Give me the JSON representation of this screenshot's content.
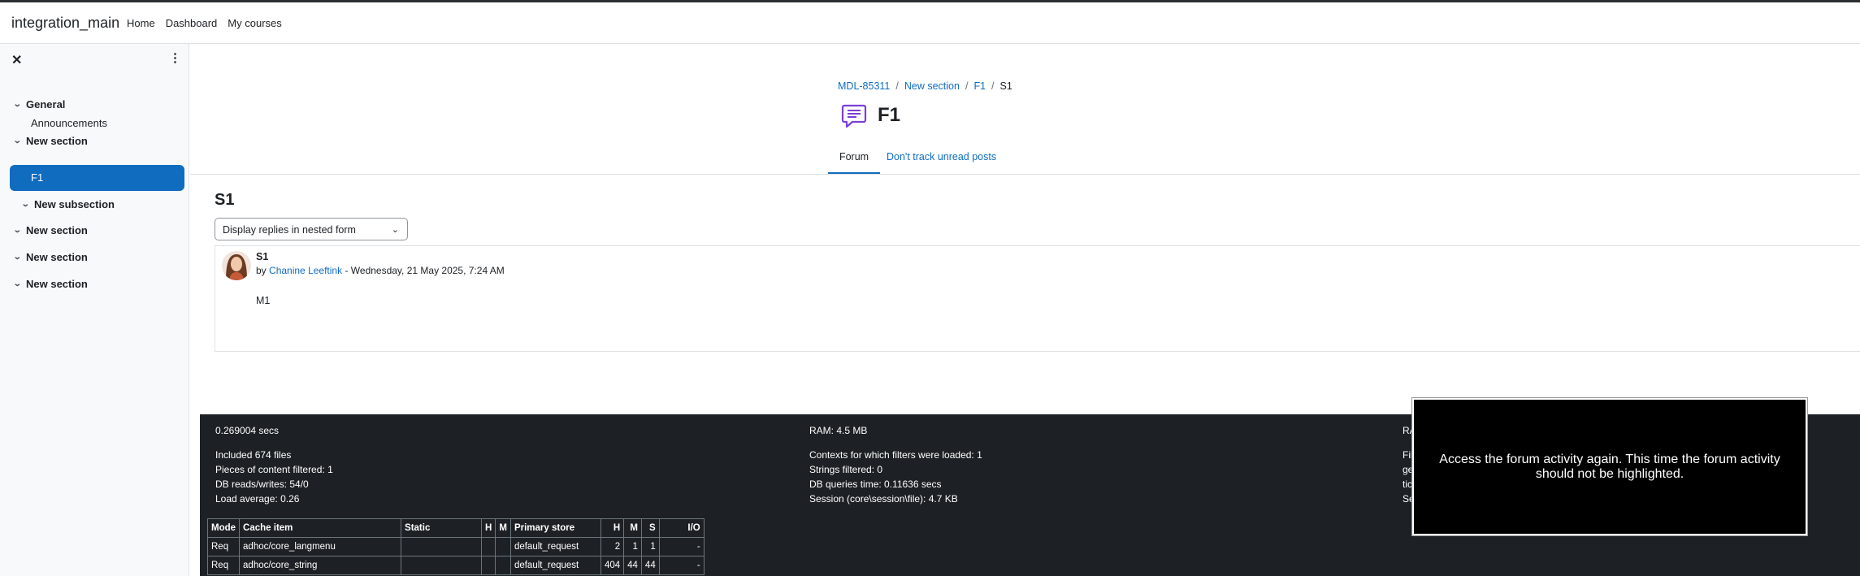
{
  "navbar": {
    "brand": "integration_main",
    "links": [
      "Home",
      "Dashboard",
      "My courses"
    ]
  },
  "course_index": {
    "close_icon": "close-icon",
    "menu_icon": "kebab-menu-icon",
    "items": [
      {
        "label": "General",
        "type": "section"
      },
      {
        "label": "Announcements",
        "type": "activity"
      },
      {
        "label": "New section",
        "type": "section"
      },
      {
        "label": "F1",
        "type": "activity",
        "active": true
      },
      {
        "label": "New subsection",
        "type": "subsection"
      },
      {
        "label": "New section",
        "type": "section"
      },
      {
        "label": "New section",
        "type": "section"
      },
      {
        "label": "New section",
        "type": "section"
      }
    ]
  },
  "breadcrumb": [
    "MDL-85311",
    "New section",
    "F1",
    "S1"
  ],
  "page": {
    "title": "F1",
    "icon": "forum-icon",
    "tabs": [
      {
        "label": "Forum",
        "active": true
      },
      {
        "label": "Don't track unread posts",
        "active": false
      }
    ]
  },
  "discussion": {
    "title": "S1",
    "display_mode": "Display replies in nested form",
    "post": {
      "subject": "S1",
      "by": "by",
      "author": "Chanine Leeftink",
      "date": "- Wednesday, 21 May 2025, 7:24 AM",
      "message": "M1"
    }
  },
  "footer": {
    "col1": {
      "time": "0.269004 secs",
      "lines": [
        "Included 674 files",
        "Pieces of content filtered: 1",
        "DB reads/writes: 54/0",
        "Load average: 0.26"
      ]
    },
    "col2": {
      "ram": "RAM: 4.5 MB",
      "lines": [
        "Contexts for which filters were loaded: 1",
        "Strings filtered: 0",
        "DB queries time: 0.11636 secs",
        "Session (core\\session\\file): 4.7 KB"
      ]
    },
    "col3": {
      "head": "RA",
      "lines": [
        "Fil",
        "ge",
        "tic",
        "Se"
      ]
    },
    "table": {
      "headers": [
        "Mode",
        "Cache item",
        "Static",
        "H",
        "M",
        "Primary store",
        "H",
        "M",
        "S",
        "I/O"
      ],
      "rows": [
        [
          "Req",
          "adhoc/core_langmenu",
          "",
          "",
          "",
          "default_request",
          "2",
          "1",
          "1",
          "-"
        ],
        [
          "Req",
          "adhoc/core_string",
          "",
          "",
          "",
          "default_request",
          "404",
          "44",
          "44",
          "-"
        ]
      ]
    }
  },
  "overlay": {
    "text": "Access the forum activity again. This time the forum activity should not be highlighted."
  },
  "colors": {
    "link": "#0f6cbf",
    "active_bg": "#0f6cbf",
    "footer_bg": "#1d2125",
    "forum_icon": "#7b3fd6"
  }
}
